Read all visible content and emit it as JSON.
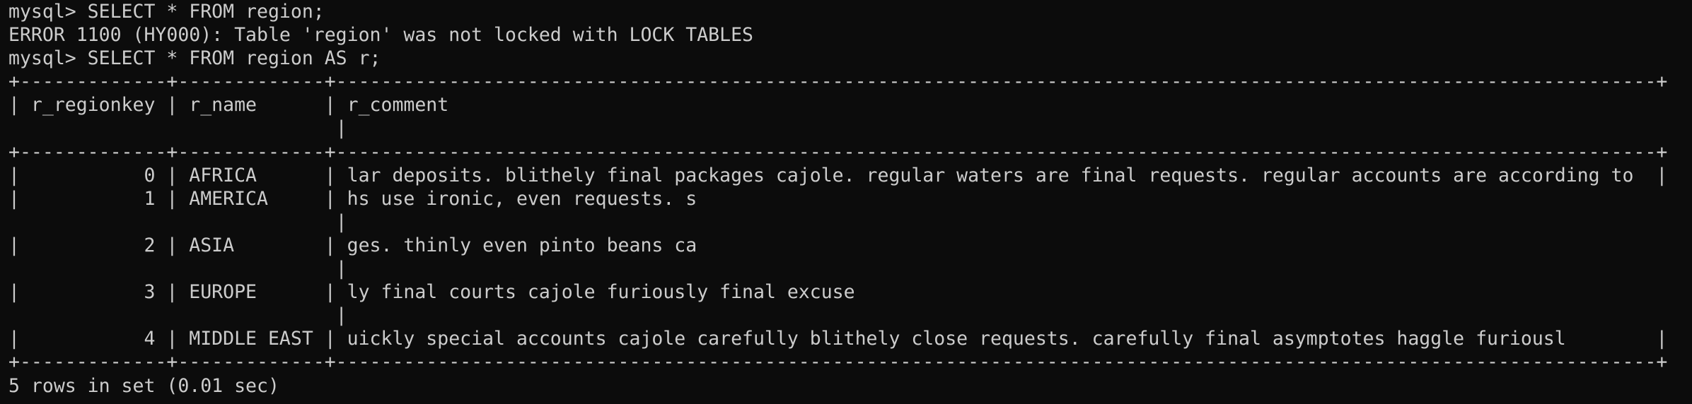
{
  "terminal": {
    "lines": [
      "mysql> SELECT * FROM region;",
      "ERROR 1100 (HY000): Table 'region' was not locked with LOCK TABLES",
      "mysql> SELECT * FROM region AS r;",
      "+-------------+-------------+---------------------------------------------------------------------------------------------------------------------+",
      "| r_regionkey | r_name      | r_comment",
      "                             |",
      "+-------------+-------------+---------------------------------------------------------------------------------------------------------------------+",
      "|           0 | AFRICA      | lar deposits. blithely final packages cajole. regular waters are final requests. regular accounts are according to  |",
      "|           1 | AMERICA     | hs use ironic, even requests. s",
      "                             |",
      "|           2 | ASIA        | ges. thinly even pinto beans ca",
      "                             |",
      "|           3 | EUROPE      | ly final courts cajole furiously final excuse",
      "                             |",
      "|           4 | MIDDLE EAST | uickly special accounts cajole carefully blithely close requests. carefully final asymptotes haggle furiousl        |",
      "+-------------+-------------+---------------------------------------------------------------------------------------------------------------------+",
      "5 rows in set (0.01 sec)"
    ]
  }
}
